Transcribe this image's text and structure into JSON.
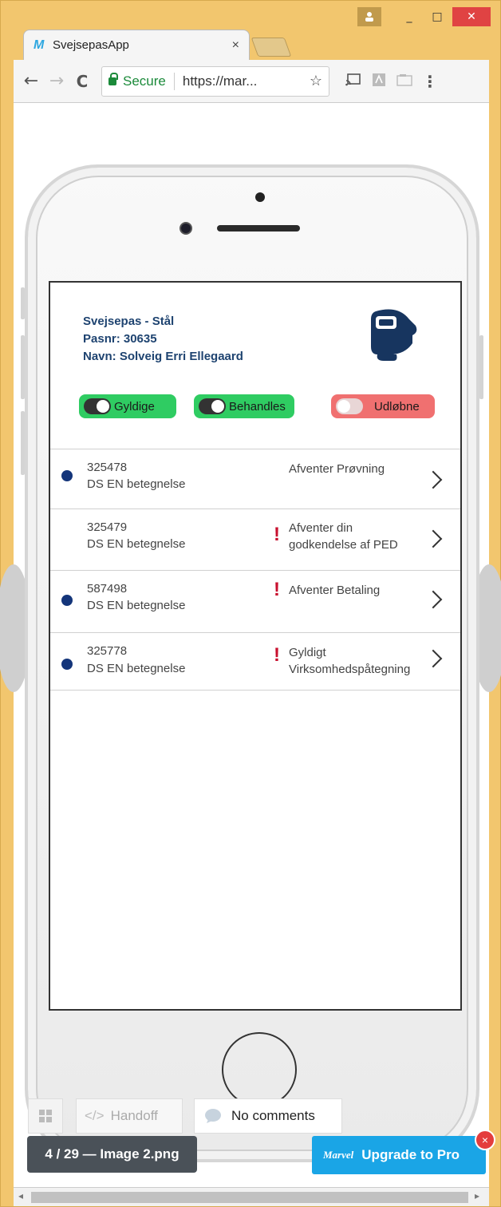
{
  "window": {
    "profile_icon": "person-icon",
    "min_label": "_",
    "max_label": "□",
    "close_label": "✕"
  },
  "tab": {
    "logo": "M",
    "title": "SvejsepasApp",
    "close": "×"
  },
  "toolbar": {
    "back": "←",
    "forward": "→",
    "reload": "C",
    "secure_label": "Secure",
    "url": "https://mar...",
    "star": "☆",
    "menu": "⋮"
  },
  "app": {
    "header": {
      "line1": "Svejsepas - Stål",
      "line2": "Pasnr: 30635",
      "line3": "Navn: Solveig Erri Ellegaard"
    },
    "toggles": [
      {
        "label": "Gyldige",
        "color": "#2fcc62",
        "on": true
      },
      {
        "label": "Behandles",
        "color": "#2fcc62",
        "on": true
      },
      {
        "label": "Udløbne",
        "color": "#f07070",
        "on": false
      }
    ],
    "rows": [
      {
        "number": "325478",
        "desc": "DS EN betegnelse",
        "status1": "Afventer Prøvning",
        "status2": "",
        "dot": true,
        "alert": false
      },
      {
        "number": "325479",
        "desc": "DS EN betegnelse",
        "status1": "Afventer din",
        "status2": "godkendelse af PED",
        "dot": false,
        "alert": true
      },
      {
        "number": "587498",
        "desc": "DS EN betegnelse",
        "status1": "Afventer Betaling",
        "status2": "",
        "dot": true,
        "alert": true
      },
      {
        "number": "325778",
        "desc": "DS EN betegnelse",
        "status1": "Gyldigt",
        "status2": "Virksomhedspåtegning",
        "dot": true,
        "alert": true
      }
    ],
    "alert_mark": "!"
  },
  "marvel": {
    "handoff_label": "Handoff",
    "handoff_icon": "</>",
    "comments_label": "No comments",
    "counter": "4 / 29 — Image 2.png",
    "upgrade_logo": "Marvel",
    "upgrade_label": "Upgrade to Pro",
    "close_badge": "×"
  },
  "scrollbar": {
    "left_arrow": "◂",
    "right_arrow": "▸"
  }
}
